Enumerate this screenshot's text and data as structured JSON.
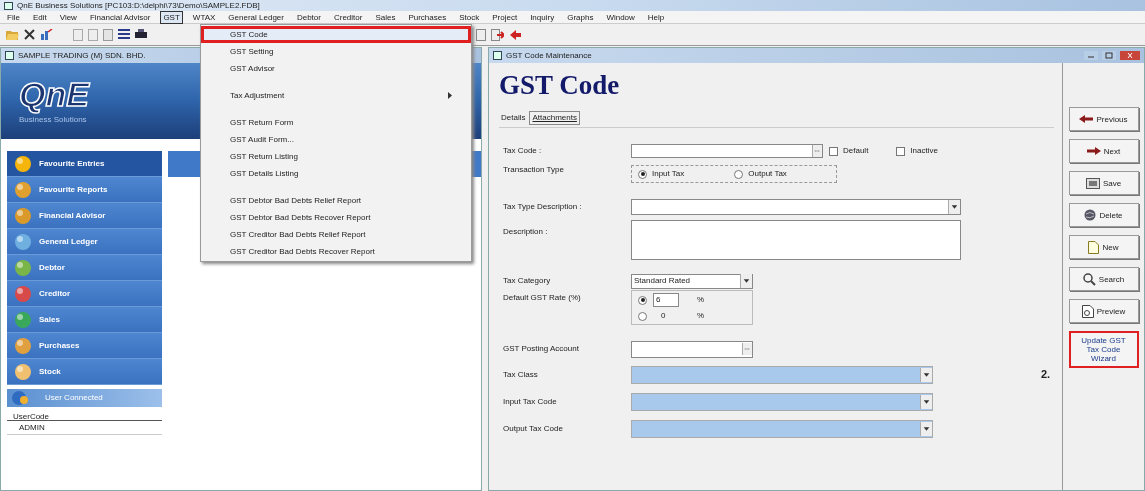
{
  "title_bar": {
    "title": "QnE Business Solutions [PC103:D:\\delphi\\73\\Demo\\SAMPLE2.FDB]"
  },
  "menu_bar": [
    {
      "label": "File",
      "selected": false
    },
    {
      "label": "Edit",
      "selected": false
    },
    {
      "label": "View",
      "selected": false
    },
    {
      "label": "Financial Advisor",
      "selected": false
    },
    {
      "label": "GST",
      "selected": true
    },
    {
      "label": "WTAX",
      "selected": false
    },
    {
      "label": "General Ledger",
      "selected": false
    },
    {
      "label": "Debtor",
      "selected": false
    },
    {
      "label": "Creditor",
      "selected": false
    },
    {
      "label": "Sales",
      "selected": false
    },
    {
      "label": "Purchases",
      "selected": false
    },
    {
      "label": "Stock",
      "selected": false
    },
    {
      "label": "Project",
      "selected": false
    },
    {
      "label": "Inquiry",
      "selected": false
    },
    {
      "label": "Graphs",
      "selected": false
    },
    {
      "label": "Window",
      "selected": false
    },
    {
      "label": "Help",
      "selected": false
    }
  ],
  "gst_menu": {
    "groups": [
      [
        {
          "label": "GST Code",
          "highlighted": true,
          "submenu": false
        },
        {
          "label": "GST Setting",
          "highlighted": false,
          "submenu": false
        },
        {
          "label": "GST Advisor",
          "highlighted": false,
          "submenu": false
        }
      ],
      [
        {
          "label": "Tax Adjustment",
          "highlighted": false,
          "submenu": true
        }
      ],
      [
        {
          "label": "GST Return Form",
          "highlighted": false,
          "submenu": false
        },
        {
          "label": "GST Audit Form...",
          "highlighted": false,
          "submenu": false
        },
        {
          "label": "GST Return Listing",
          "highlighted": false,
          "submenu": false
        },
        {
          "label": "GST Details Listing",
          "highlighted": false,
          "submenu": false
        }
      ],
      [
        {
          "label": "GST Debtor Bad Debts Relief Report",
          "highlighted": false,
          "submenu": false
        },
        {
          "label": "GST Debtor Bad Debts Recover Report",
          "highlighted": false,
          "submenu": false
        },
        {
          "label": "GST Creditor Bad Debts Relief Report",
          "highlighted": false,
          "submenu": false
        },
        {
          "label": "GST Creditor Bad Debts Recover Report",
          "highlighted": false,
          "submenu": false
        }
      ]
    ]
  },
  "company_window": {
    "title": "SAMPLE TRADING (M) SDN. BHD.",
    "logo": "QnE",
    "logo_tagline": "Business Solutions",
    "modules": [
      "Favourite Entries",
      "Favourite Reports",
      "Financial Advisor",
      "General Ledger",
      "Debtor",
      "Creditor",
      "Sales",
      "Purchases",
      "Stock"
    ],
    "users_panel": {
      "title": "User Connected",
      "column": "UserCode",
      "rows": [
        "ADMIN"
      ]
    }
  },
  "form_window": {
    "title": "GST Code Maintenance",
    "heading": "GST Code",
    "tabs": [
      {
        "label": "Details",
        "selected": true
      },
      {
        "label": "Attachments",
        "selected": false
      }
    ],
    "tax_code": {
      "label": "Tax Code :"
    },
    "checkboxes": [
      {
        "label": "Default",
        "checked": false
      },
      {
        "label": "Inactive",
        "checked": false
      }
    ],
    "transaction_type": {
      "label": "Transaction Type",
      "options": [
        {
          "label": "Input Tax",
          "selected": true
        },
        {
          "label": "Output Tax",
          "selected": false
        }
      ]
    },
    "tax_type_description": {
      "label": "Tax Type Description :"
    },
    "description": {
      "label": "Description :"
    },
    "tax_category": {
      "label": "Tax Category",
      "value": "Standard Rated"
    },
    "gst_rate": {
      "label": "Default GST Rate (%)",
      "options": [
        {
          "value": "6",
          "unit": "%",
          "selected": true,
          "editable": true
        },
        {
          "value": "0",
          "unit": "%",
          "selected": false,
          "editable": false
        }
      ]
    },
    "posting_account": {
      "label": "GST Posting Account"
    },
    "lookups": [
      {
        "label": "Tax Class",
        "disabled": true
      },
      {
        "label": "Input Tax Code",
        "disabled": true
      },
      {
        "label": "Output Tax Code",
        "disabled": true
      }
    ],
    "actions": [
      {
        "label": "Previous",
        "kind": "previous",
        "highlighted": false
      },
      {
        "label": "Next",
        "kind": "next",
        "highlighted": false
      },
      {
        "label": "Save",
        "kind": "save",
        "highlighted": false
      },
      {
        "label": "Delete",
        "kind": "delete",
        "highlighted": false
      },
      {
        "label": "New",
        "kind": "new",
        "highlighted": false
      },
      {
        "label": "Search",
        "kind": "search",
        "highlighted": false
      },
      {
        "label": "Preview",
        "kind": "preview",
        "highlighted": false
      },
      {
        "label": "Update GST Tax Code Wizard",
        "kind": "wizard",
        "highlighted": true
      }
    ],
    "annotation": "2."
  }
}
